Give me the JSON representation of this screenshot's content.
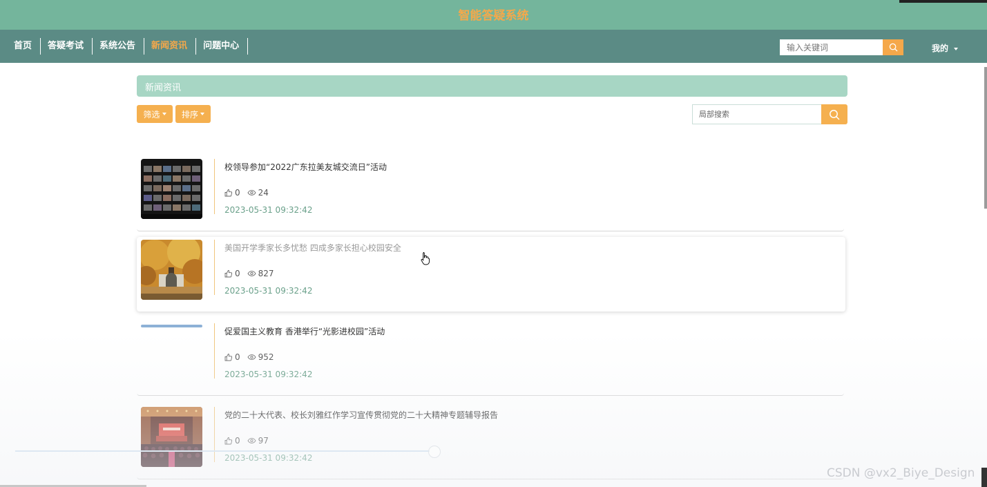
{
  "header": {
    "site_title": "智能答疑系统"
  },
  "nav": {
    "items": [
      {
        "label": "首页",
        "active": false
      },
      {
        "label": "答疑考试",
        "active": false
      },
      {
        "label": "系统公告",
        "active": false
      },
      {
        "label": "新闻资讯",
        "active": true
      },
      {
        "label": "问题中心",
        "active": false
      }
    ],
    "search_placeholder": "输入关键词",
    "user_label": "我的"
  },
  "section": {
    "title": "新闻资讯",
    "filter_label": "筛选",
    "sort_label": "排序",
    "search_placeholder": "局部搜索"
  },
  "news": [
    {
      "title": "校领导参加“2022广东拉美友城交流日”活动",
      "likes": "0",
      "views": "24",
      "date": "2023-05-31 09:32:42"
    },
    {
      "title": "美国开学季家长多忧愁 四成多家长担心校园安全",
      "likes": "0",
      "views": "827",
      "date": "2023-05-31 09:32:42"
    },
    {
      "title": "促爱国主义教育 香港举行“光影进校园”活动",
      "likes": "0",
      "views": "952",
      "date": "2023-05-31 09:32:42"
    },
    {
      "title": "党的二十大代表、校长刘雅红作学习宣传贯彻党的二十大精神专题辅导报告",
      "likes": "0",
      "views": "97",
      "date": "2023-05-31 09:32:42"
    }
  ],
  "watermark": "CSDN @vx2_Biye_Design",
  "colors": {
    "header": "#74b59c",
    "navbar": "#5b8b85",
    "accent": "#f5a84a",
    "section": "#a7d6c4"
  }
}
